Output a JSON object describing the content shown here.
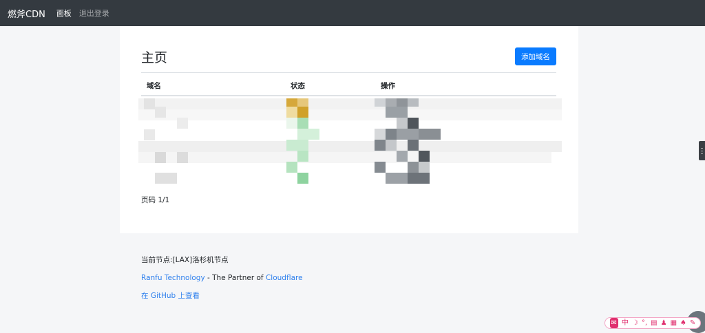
{
  "navbar": {
    "brand": "燃斧CDN",
    "links": [
      {
        "label": "面板"
      },
      {
        "label": "退出登录"
      }
    ]
  },
  "main": {
    "title": "主页",
    "add_button": "添加域名",
    "table": {
      "columns": [
        "域名",
        "状态",
        "操作"
      ]
    },
    "pagination": "页码 1/1"
  },
  "footer": {
    "node": "当前节点:[LAX]洛杉机节点",
    "company_link": "Ranfu Technology",
    "partner_text": " - The Partner of ",
    "partner_link": "Cloudflare",
    "github_link": "在 GitHub 上查看"
  },
  "colors": {
    "navbar_bg": "#343a40",
    "primary": "#0a7bff",
    "link": "#2f80ed"
  },
  "ime_toolbar": {
    "items": [
      "中"
    ]
  },
  "icons": [
    "scroll-handle-icon",
    "settings-round-icon"
  ]
}
